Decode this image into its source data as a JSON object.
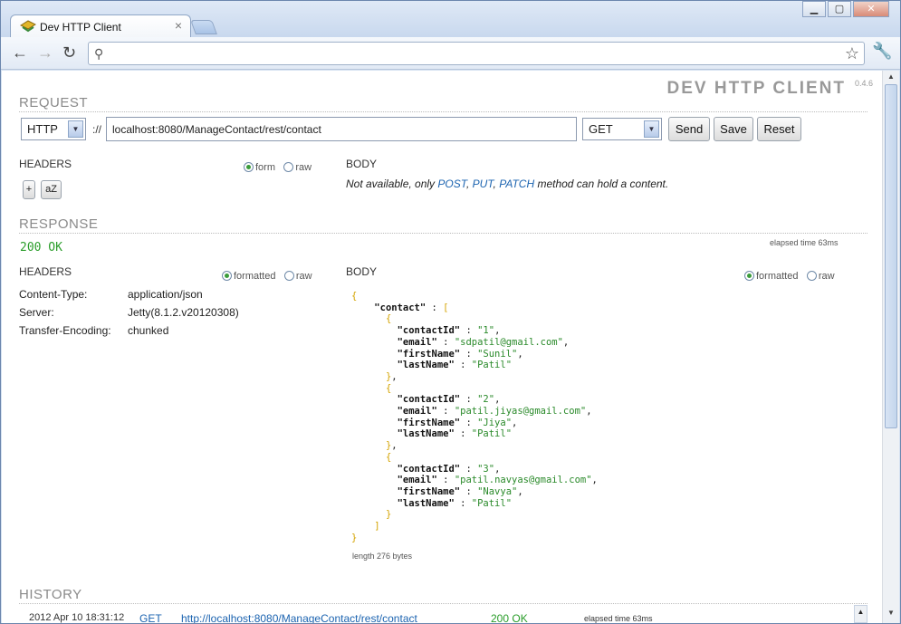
{
  "browser": {
    "tab_title": "Dev HTTP Client",
    "tab_close": "×",
    "window_buttons": [
      "▁",
      "▢",
      "✕"
    ],
    "nav": {
      "back": "←",
      "forward": "→",
      "reload": "↻"
    },
    "omnibox_value": "",
    "omnibox_icon": "search-icon",
    "star_icon": "star-icon",
    "wrench_icon": "wrench-icon"
  },
  "app": {
    "title": "DEV HTTP CLIENT",
    "version": "0.4.6"
  },
  "request": {
    "heading": "REQUEST",
    "protocol": "HTTP",
    "separator": "://",
    "url": "localhost:8080/ManageContact/rest/contact",
    "method": "GET",
    "buttons": {
      "send": "Send",
      "save": "Save",
      "reset": "Reset"
    },
    "headers_label": "HEADERS",
    "headers_mode": {
      "form": "form",
      "raw": "raw",
      "selected": "form"
    },
    "add_button": "+",
    "sort_button": "aZ",
    "body_label": "BODY",
    "body_note_prefix": "Not available, only ",
    "body_note_post": "POST",
    "body_note_sep1": ", ",
    "body_note_put": "PUT",
    "body_note_sep2": ", ",
    "body_note_patch": "PATCH",
    "body_note_suffix": " method can hold a content."
  },
  "response": {
    "heading": "RESPONSE",
    "status": "200 OK",
    "elapsed": "elapsed time 63ms",
    "headers_label": "HEADERS",
    "headers_mode": {
      "formatted": "formatted",
      "raw": "raw",
      "selected": "formatted"
    },
    "headers": [
      {
        "key": "Content-Type:",
        "value": "application/json"
      },
      {
        "key": "Server:",
        "value": "Jetty(8.1.2.v20120308)"
      },
      {
        "key": "Transfer-Encoding:",
        "value": "chunked"
      }
    ],
    "body_label": "BODY",
    "body_mode": {
      "formatted": "formatted",
      "raw": "raw",
      "selected": "formatted"
    },
    "body": {
      "contact": [
        {
          "contactId": "1",
          "email": "sdpatil@gmail.com",
          "firstName": "Sunil",
          "lastName": "Patil"
        },
        {
          "contactId": "2",
          "email": "patil.jiyas@gmail.com",
          "firstName": "Jiya",
          "lastName": "Patil"
        },
        {
          "contactId": "3",
          "email": "patil.navyas@gmail.com",
          "firstName": "Navya",
          "lastName": "Patil"
        }
      ]
    },
    "length": "length 276 bytes"
  },
  "history": {
    "heading": "HISTORY",
    "rows": [
      {
        "date": "2012 Apr 10 18:31:12",
        "method": "GET",
        "url": "http://localhost:8080/ManageContact/rest/contact",
        "status": "200 OK",
        "elapsed": "elapsed time 63ms"
      }
    ]
  },
  "colors": {
    "status_ok": "#2a9d2a",
    "link": "#1b63b0",
    "json_string": "#2a8a2a",
    "json_bracket": "#d4a300"
  }
}
